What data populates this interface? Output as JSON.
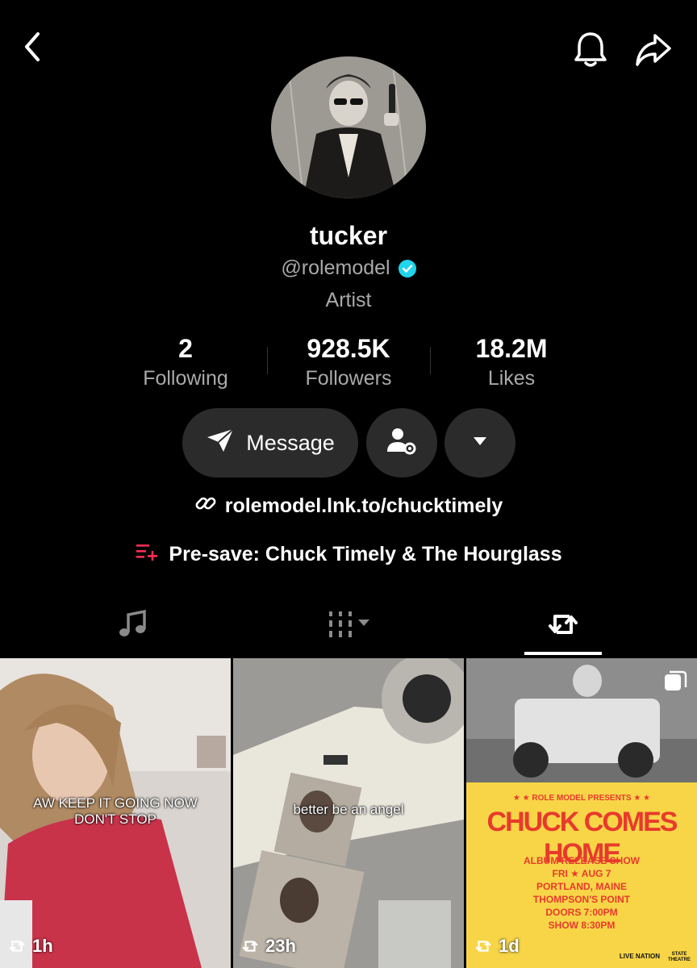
{
  "profile": {
    "display_name": "tucker",
    "handle": "@rolemodel",
    "category": "Artist"
  },
  "stats": [
    {
      "value": "2",
      "label": "Following"
    },
    {
      "value": "928.5K",
      "label": "Followers"
    },
    {
      "value": "18.2M",
      "label": "Likes"
    }
  ],
  "actions": {
    "message_label": "Message"
  },
  "bio": {
    "link": "rolemodel.lnk.to/chucktimely",
    "presave": "Pre-save: Chuck Timely & The Hourglass"
  },
  "tabs": [
    {
      "icon": "music-note-icon"
    },
    {
      "icon": "grid-view-icon"
    },
    {
      "icon": "repost-icon",
      "active": true
    }
  ],
  "videos": [
    {
      "caption": "AW KEEP IT GOING NOW DON'T STOP",
      "age": "1h"
    },
    {
      "caption": "better be an angel",
      "age": "23h"
    },
    {
      "caption": "",
      "age": "1d",
      "poster": {
        "presenter": "★ ★ ROLE MODEL PRESENTS ★ ★",
        "title": "CHUCK COMES HOME",
        "lines": [
          "ALBUM RELEASE SHOW",
          "FRI ★ AUG 7",
          "PORTLAND, MAINE",
          "THOMPSON'S POINT",
          "DOORS 7:00PM",
          "SHOW 8:30PM"
        ],
        "sponsor_left": "LIVE NATION",
        "sponsor_right": "STATE THEATRE"
      }
    }
  ],
  "colors": {
    "accent_red": "#fe2c55",
    "verified_blue": "#20d5ec",
    "poster_yellow": "#f7d547"
  }
}
